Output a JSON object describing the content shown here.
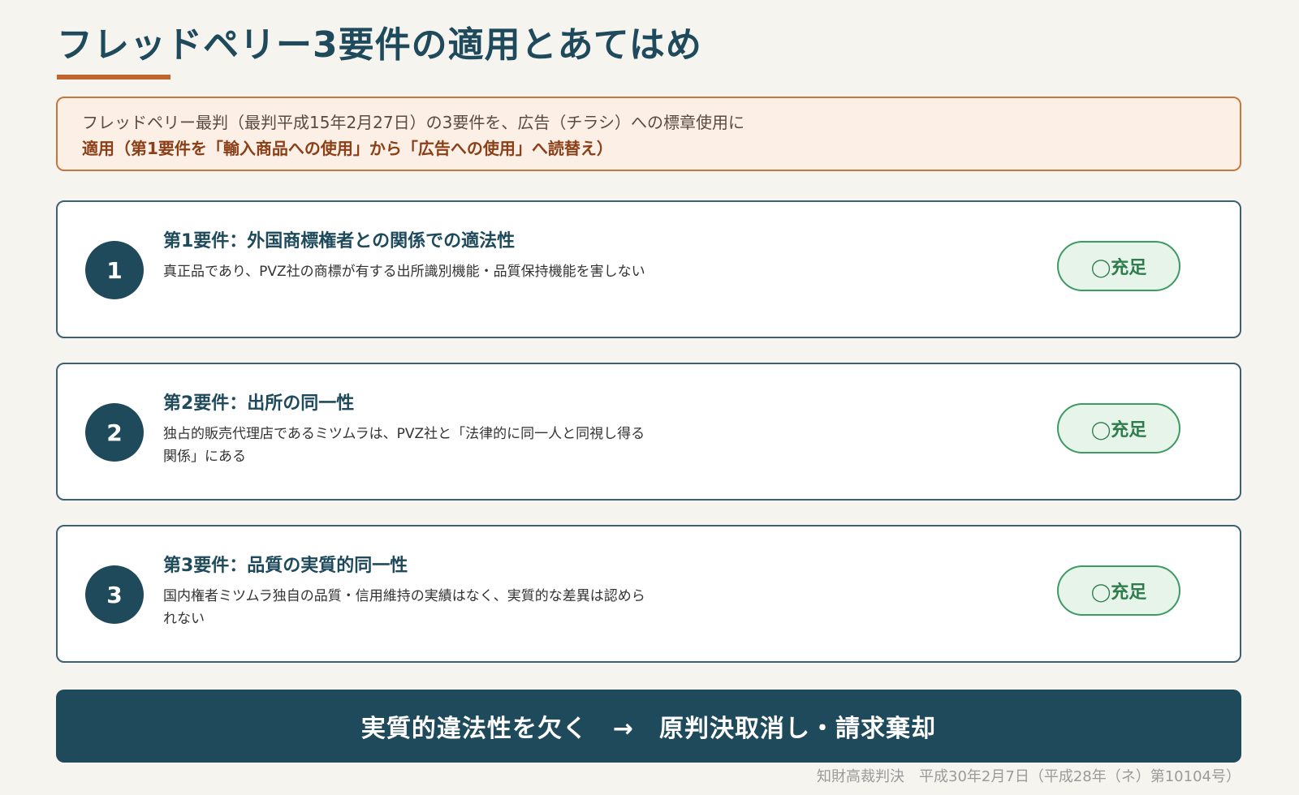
{
  "header": {
    "title": "フレッドペリー3要件の適用とあてはめ"
  },
  "intro": {
    "line1": "フレッドペリー最判（最判平成15年2月27日）の3要件を、広告（チラシ）への標章使用に",
    "line2": "適用（第1要件を「輸入商品への使用」から「広告への使用」へ読替え）"
  },
  "requirements": [
    {
      "number": "1",
      "title": "第1要件：外国商標権者との関係での適法性",
      "description": "真正品であり、PVZ社の商標が有する出所識別機能・品質保持機能を害しない",
      "status": "◯充足"
    },
    {
      "number": "2",
      "title": "第2要件：出所の同一性",
      "description": "独占的販売代理店であるミツムラは、PVZ社と「法律的に同一人と同視し得る関係」にある",
      "status": "◯充足"
    },
    {
      "number": "3",
      "title": "第3要件：品質の実質的同一性",
      "description": "国内権者ミツムラ独自の品質・信用維持の実績はなく、実質的な差異は認められない",
      "status": "◯充足"
    }
  ],
  "conclusion": {
    "text": "実質的違法性を欠く　→　原判決取消し・請求棄却"
  },
  "footer": {
    "source": "知財高裁判決　平成30年2月7日（平成28年（ネ）第10104号）"
  },
  "colors": {
    "primary": "#1f4a5c",
    "accent": "#c0652e",
    "intro_bg": "#fcefe6",
    "status_green": "#2f7d4c",
    "status_bg": "#e6f4ea"
  }
}
